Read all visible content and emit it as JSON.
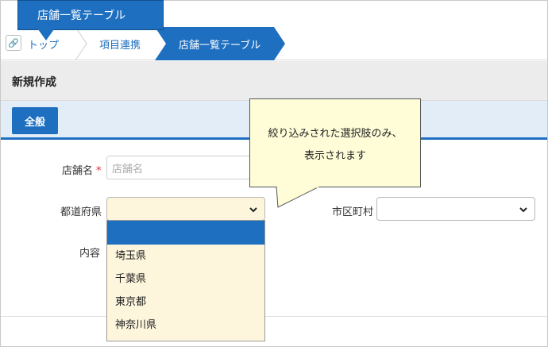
{
  "tag": {
    "label": "店舗一覧テーブル"
  },
  "breadcrumb": {
    "home_icon": "link-icon",
    "top_label": "トップ",
    "item_label": "項目連携",
    "active_label": "店舗一覧テーブル"
  },
  "section": {
    "title": "新規作成"
  },
  "tabs": [
    {
      "label": "全般"
    }
  ],
  "form": {
    "store_name_label": "店舗名",
    "required_mark": "*",
    "store_name_placeholder": "店舗名",
    "prefecture_label": "都道府県",
    "prefecture_value": "",
    "city_label": "市区町村",
    "city_value": "",
    "content_label": "内容"
  },
  "dropdown": {
    "options": [
      "",
      "埼玉県",
      "千葉県",
      "東京都",
      "神奈川県"
    ],
    "highlighted_index": 0
  },
  "callout": {
    "line1": "絞り込みされた選択肢のみ、",
    "line2": "表示されます"
  },
  "colors": {
    "accent": "#1e6fc0",
    "select_bg": "#fdf6dd",
    "bubble_bg": "#fefdd8",
    "required": "#e0283c"
  }
}
